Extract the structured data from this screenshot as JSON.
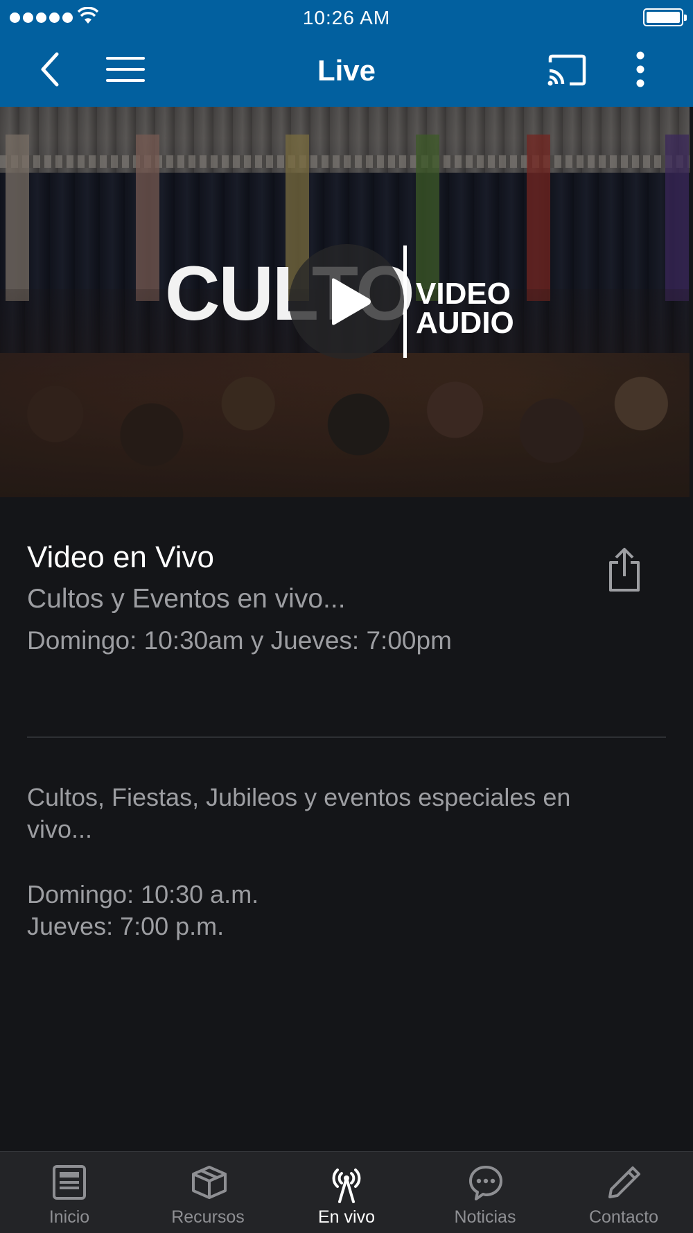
{
  "status_bar": {
    "time": "10:26 AM",
    "signal_icon": "signal-dots-icon",
    "wifi_icon": "wifi-icon",
    "battery_icon": "battery-icon"
  },
  "nav_bar": {
    "title": "Live",
    "back_icon": "back-chevron-icon",
    "menu_icon": "hamburger-menu-icon",
    "cast_icon": "cast-icon",
    "more_icon": "more-vertical-icon",
    "background_color": "#02609F"
  },
  "hero": {
    "logo_main": "CULTO",
    "logo_line1": "VIDEO",
    "logo_line2": "AUDIO",
    "play_icon": "play-icon"
  },
  "content": {
    "title": "Video en Vivo",
    "subtitle": "Cultos y Eventos en vivo...",
    "schedule": "Domingo: 10:30am y Jueves: 7:00pm",
    "share_icon": "share-icon",
    "description": "Cultos, Fiestas, Jubileos y eventos especiales en vivo...",
    "time_sunday": "Domingo: 10:30 a.m.",
    "time_thursday": "Jueves: 7:00 p.m."
  },
  "tab_bar": {
    "active_index": 2,
    "tabs": [
      {
        "label": "Inicio",
        "icon": "news-icon"
      },
      {
        "label": "Recursos",
        "icon": "box-icon"
      },
      {
        "label": "En vivo",
        "icon": "broadcast-antenna-icon"
      },
      {
        "label": "Noticias",
        "icon": "chat-bubble-icon"
      },
      {
        "label": "Contacto",
        "icon": "pencil-icon"
      }
    ]
  },
  "colors": {
    "accent": "#02609F",
    "background": "#141518",
    "tab_bar": "#232427",
    "secondary_text": "#9D9EA2",
    "active_tab": "#FFFFFF",
    "inactive_tab": "#8E8F93"
  }
}
